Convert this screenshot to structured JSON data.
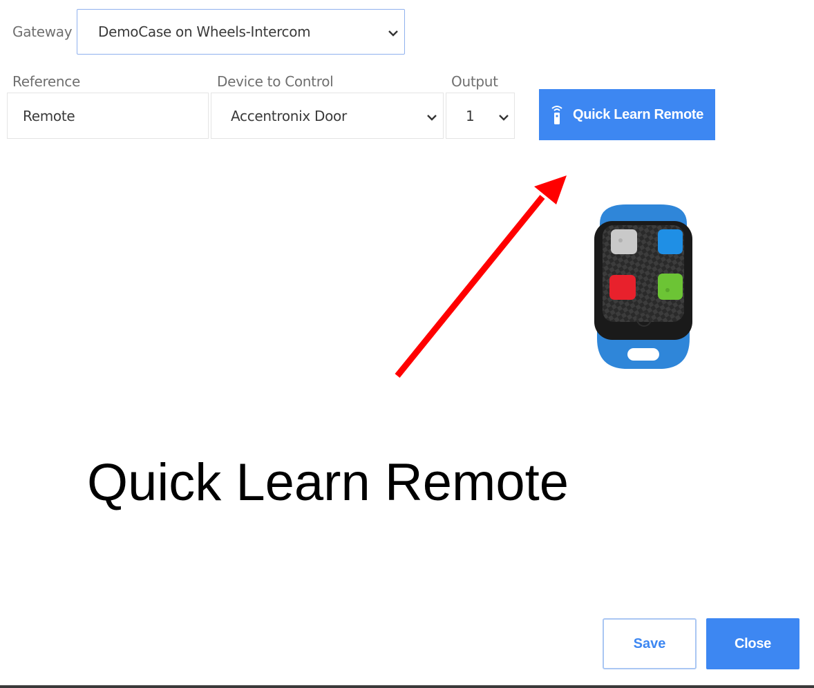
{
  "form": {
    "gateway_label": "Gateway",
    "gateway_value": "DemoCase on Wheels-Intercom",
    "reference_label": "Reference",
    "reference_value": "Remote",
    "device_label": "Device to Control",
    "device_value": "Accentronix Door",
    "output_label": "Output",
    "output_value": "1"
  },
  "actions": {
    "quick_learn_label": "Quick Learn Remote",
    "save_label": "Save",
    "close_label": "Close"
  },
  "annotation": {
    "caption": "Quick Learn Remote"
  },
  "icons": {
    "quick_learn": "remote-signal-icon",
    "dropdown": "chevron-down-icon"
  },
  "colors": {
    "primary": "#3d87f2",
    "arrow": "#ff0000",
    "remote_shell": "#2f86d9",
    "button_grey": "#c9c9c9",
    "button_blue": "#1f8fe5",
    "button_red": "#e8212c",
    "button_green": "#6cc435"
  }
}
